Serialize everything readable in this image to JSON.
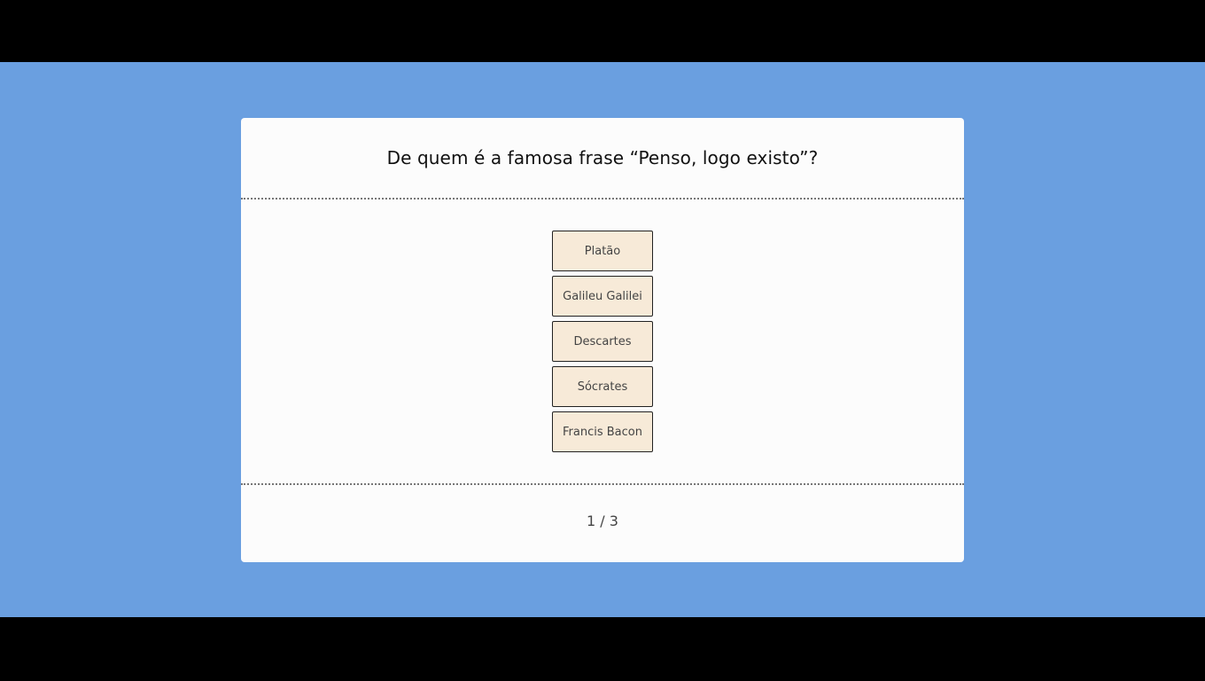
{
  "quiz": {
    "question": "De quem é a famosa frase “Penso, logo existo”?",
    "answers": [
      {
        "label": "Platão"
      },
      {
        "label": "Galileu Galilei"
      },
      {
        "label": "Descartes"
      },
      {
        "label": "Sócrates"
      },
      {
        "label": "Francis Bacon"
      }
    ],
    "progress": "1 / 3"
  },
  "colors": {
    "background": "#6a9fe0",
    "card": "#fcfcfc",
    "answer_fill": "#f7ead8",
    "letterbox": "#000000"
  }
}
